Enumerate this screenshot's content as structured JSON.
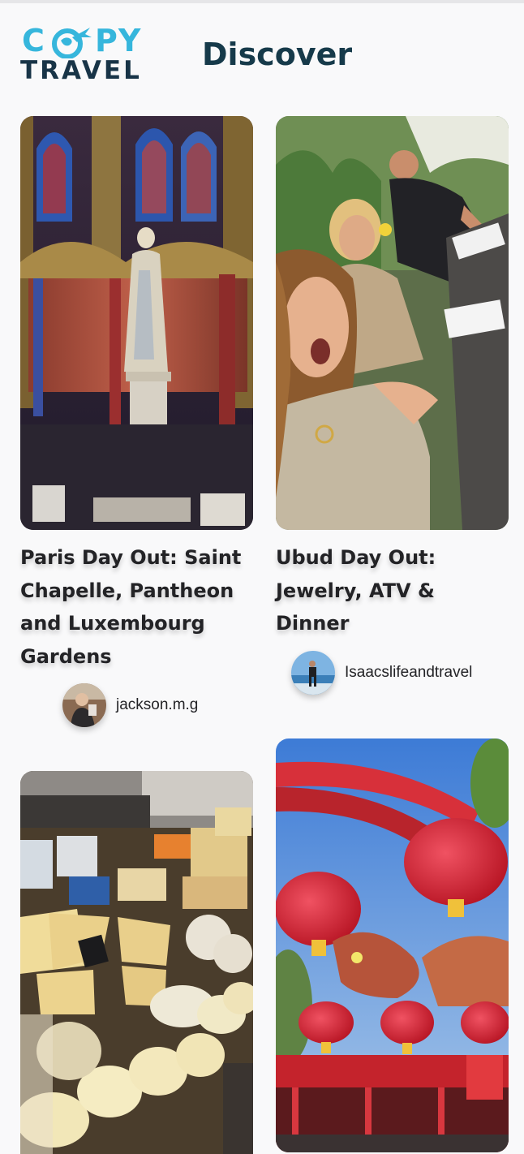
{
  "brand": {
    "logo_copy_left": "C",
    "logo_copy_right": "PY",
    "logo_travel": "TRAVEL",
    "accent_color": "#36b6dc",
    "dark_color": "#183447"
  },
  "header": {
    "title": "Discover"
  },
  "cards": [
    {
      "title": "Paris Day Out: Saint Chapelle, Pantheon and Luxembourg Gardens",
      "author": "jackson.m.g",
      "image": "sainte-chapelle-statue-photo",
      "avatar": "avatar-jackson"
    },
    {
      "title": "Ubud Day Out: Jewelry, ATV & Dinner",
      "author": "Isaacslifeandtravel",
      "image": "friends-selfie-cafe-photo",
      "avatar": "avatar-isaac"
    },
    {
      "title": "",
      "author": "",
      "image": "cheese-display-photo",
      "avatar": ""
    },
    {
      "title": "",
      "author": "",
      "image": "red-lanterns-dragon-photo",
      "avatar": ""
    }
  ]
}
